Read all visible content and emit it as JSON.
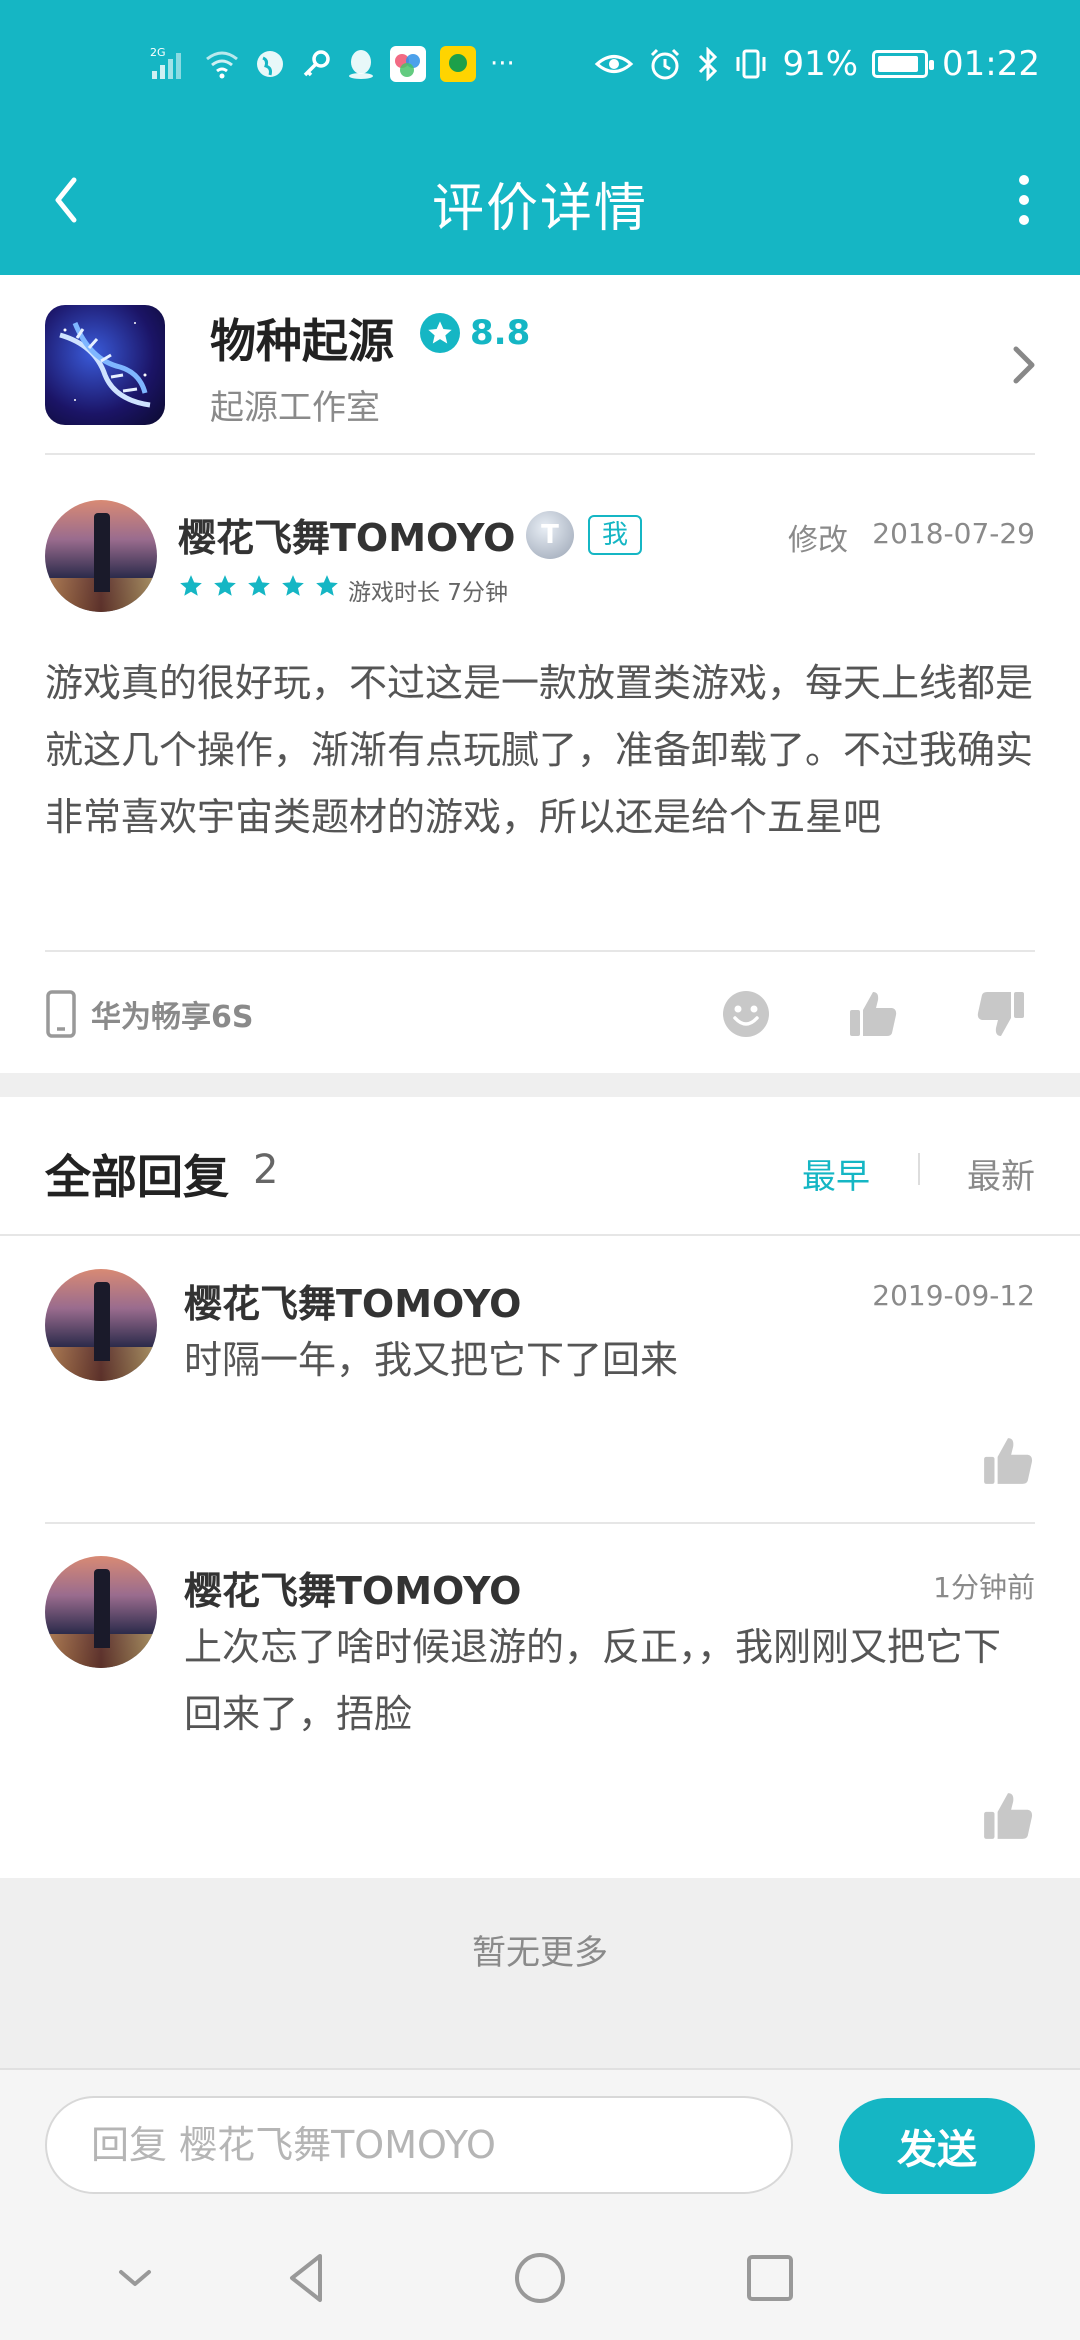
{
  "status_bar": {
    "network": "2G",
    "battery": "91%",
    "battery_level": 0.91,
    "time": "01:22",
    "more": "···"
  },
  "app_bar": {
    "title": "评价详情"
  },
  "game": {
    "name": "物种起源",
    "score": "8.8",
    "developer": "起源工作室"
  },
  "review": {
    "author": "樱花飞舞TOMOYO",
    "level_badge": "T",
    "me_badge": "我",
    "edit_label": "修改",
    "date": "2018-07-29",
    "stars": 5,
    "play_time": "游戏时长 7分钟",
    "text": "游戏真的很好玩，不过这是一款放置类游戏，每天上线都是就这几个操作，渐渐有点玩腻了，准备卸载了。不过我确实非常喜欢宇宙类题材的游戏，所以还是给个五星吧",
    "device": "华为畅享6S"
  },
  "replies": {
    "title": "全部回复",
    "count": "2",
    "sort_earliest": "最早",
    "sort_latest": "最新",
    "items": [
      {
        "author": "樱花飞舞TOMOYO",
        "time": "2019-09-12",
        "text": "时隔一年，我又把它下了回来"
      },
      {
        "author": "樱花飞舞TOMOYO",
        "time": "1分钟前",
        "text": "上次忘了啥时候退游的，反正，，我刚刚又把它下回来了，捂脸"
      }
    ],
    "no_more": "暂无更多"
  },
  "reply_bar": {
    "placeholder": "回复 樱花飞舞TOMOYO",
    "send_label": "发送"
  },
  "colors": {
    "accent": "#15b6c4",
    "icon_gray": "#c8c8c8"
  }
}
